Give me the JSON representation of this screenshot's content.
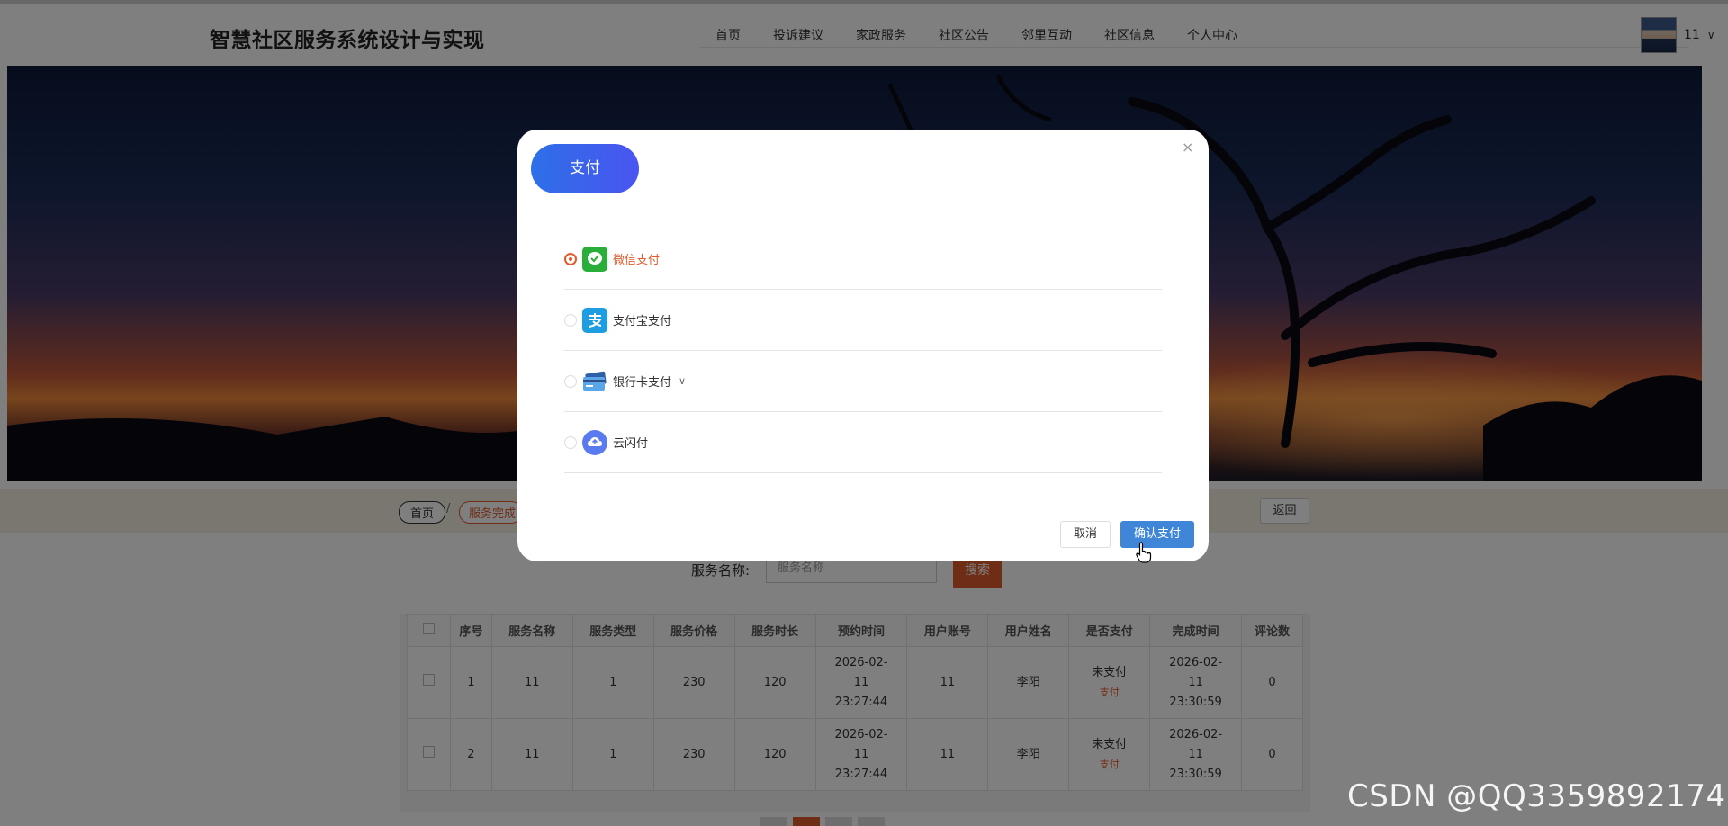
{
  "header": {
    "site_title": "智慧社区服务系统设计与实现",
    "nav": [
      "首页",
      "投诉建议",
      "家政服务",
      "社区公告",
      "邻里互动",
      "社区信息",
      "个人中心"
    ],
    "user_name": "11"
  },
  "breadcrumb": {
    "home": "首页",
    "separator": "/",
    "current": "服务完成",
    "back": "返回"
  },
  "search": {
    "label": "服务名称:",
    "placeholder": "服务名称",
    "button": "搜索"
  },
  "table": {
    "columns": [
      "序号",
      "服务名称",
      "服务类型",
      "服务价格",
      "服务时长",
      "预约时间",
      "用户账号",
      "用户姓名",
      "是否支付",
      "完成时间",
      "评论数"
    ],
    "rows": [
      {
        "index": "1",
        "name": "11",
        "type": "1",
        "price": "230",
        "duration": "120",
        "booking_date": "2026-02-",
        "booking_day": "11",
        "booking_time": "23:27:44",
        "account": "11",
        "user": "李阳",
        "paid": "未支付",
        "pay_link": "支付",
        "done_date": "2026-02-",
        "done_day": "11",
        "done_time": "23:30:59",
        "comments": "0"
      },
      {
        "index": "2",
        "name": "11",
        "type": "1",
        "price": "230",
        "duration": "120",
        "booking_date": "2026-02-",
        "booking_day": "11",
        "booking_time": "23:27:44",
        "account": "11",
        "user": "李阳",
        "paid": "未支付",
        "pay_link": "支付",
        "done_date": "2026-02-",
        "done_day": "11",
        "done_time": "23:30:59",
        "comments": "0"
      }
    ]
  },
  "modal": {
    "title": "支付",
    "close": "×",
    "methods": [
      {
        "label": "微信支付",
        "icon": "wechat-pay-icon",
        "selected": true
      },
      {
        "label": "支付宝支付",
        "icon": "alipay-icon",
        "selected": false
      },
      {
        "label": "银行卡支付",
        "icon": "bank-card-icon",
        "selected": false
      },
      {
        "label": "云闪付",
        "icon": "unionpay-cloud-icon",
        "selected": false
      }
    ],
    "cancel": "取消",
    "confirm": "确认支付"
  },
  "watermark": "CSDN @QQ3359892174",
  "colors": {
    "accent": "#e05a2b",
    "confirm": "#3f86d9",
    "tab_gradient_start": "#2e6fe8",
    "tab_gradient_end": "#4a55f0"
  }
}
